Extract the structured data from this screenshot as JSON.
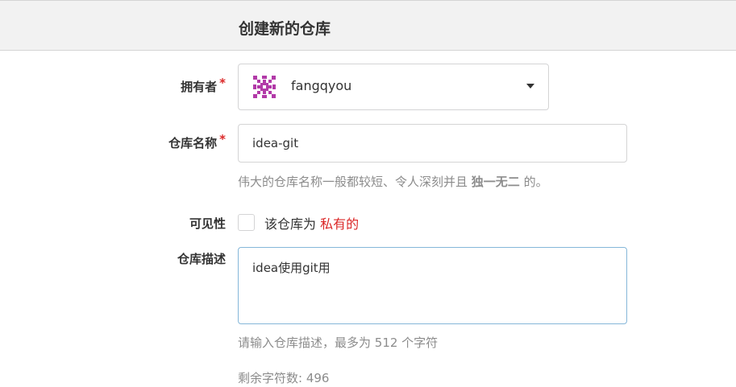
{
  "header": {
    "title": "创建新的仓库"
  },
  "owner": {
    "label": "拥有者",
    "required_mark": "*",
    "selected": "fangqyou"
  },
  "repo_name": {
    "label": "仓库名称",
    "required_mark": "*",
    "value": "idea-git",
    "help_prefix": "伟大的仓库名称一般都较短、令人深刻并且 ",
    "help_bold": "独一无二",
    "help_suffix": " 的。"
  },
  "visibility": {
    "label": "可见性",
    "checkbox_text": "该仓库为 ",
    "checkbox_private": "私有的",
    "checked": false
  },
  "description": {
    "label": "仓库描述",
    "value": "idea使用git用",
    "help": "请输入仓库描述，最多为 512 个字符",
    "remaining": "剩余字符数: 496"
  },
  "colors": {
    "required": "#db2828",
    "focus_border": "#85b7d9",
    "help_text": "#8c8c8c"
  }
}
